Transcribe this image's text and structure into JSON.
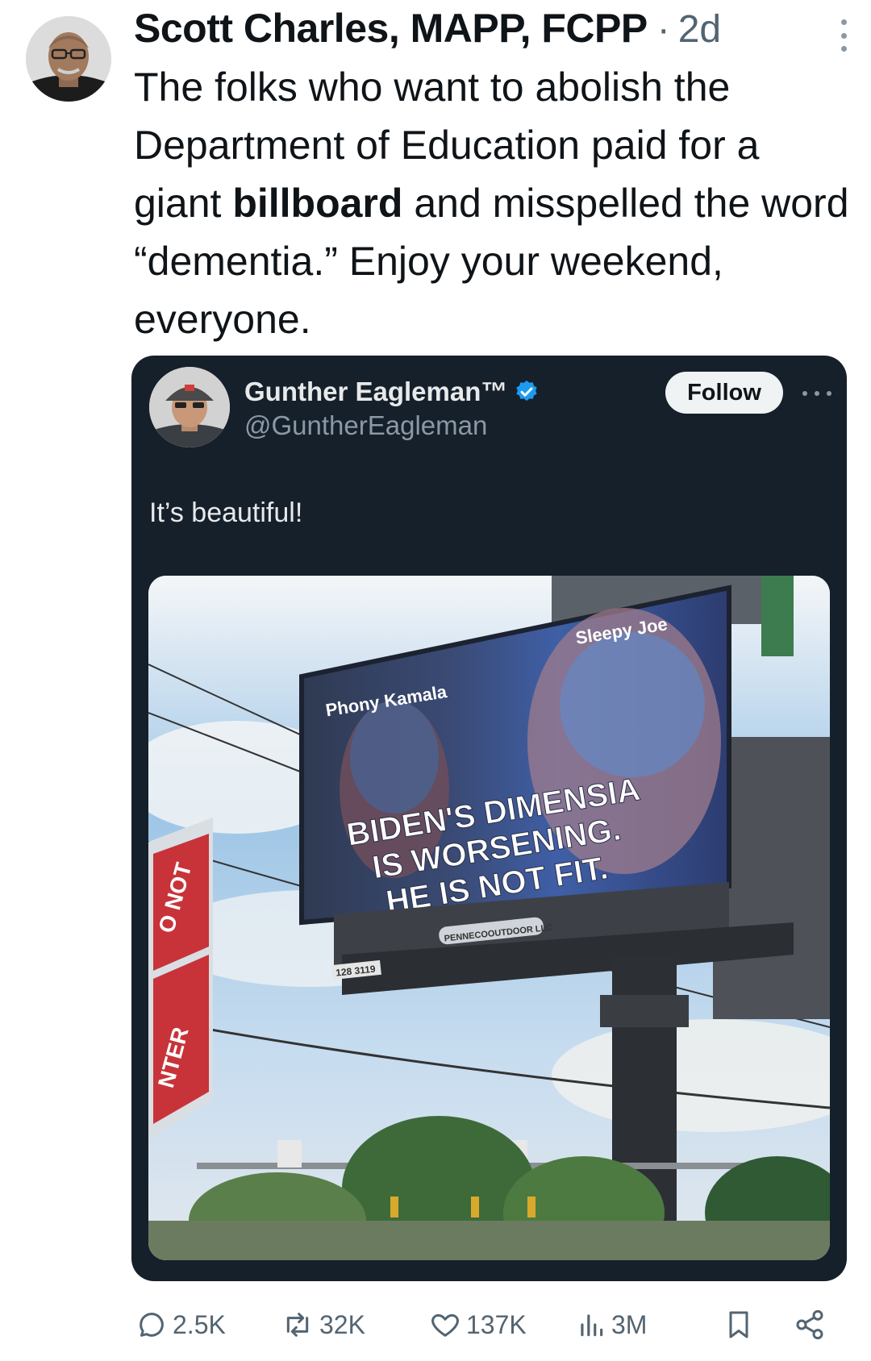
{
  "post": {
    "author_name": "Scott Charles, MAPP, FCPP",
    "separator": "·",
    "time": "2d",
    "text_before": "The folks who want to abolish the Department of Education paid for a giant ",
    "text_bold": "billboard",
    "text_after": " and misspelled the word “dementia.” Enjoy your weekend, everyone."
  },
  "quote": {
    "author_name": "Gunther Eagleman™",
    "handle": "@GuntherEagleman",
    "follow_label": "Follow",
    "text": "It’s beautiful!",
    "image": {
      "label_left": "Phony Kamala",
      "label_right": "Sleepy Joe",
      "headline_lines": [
        "BIDEN'S DIMENSIA",
        "IS WORSENING.",
        "HE IS NOT FIT."
      ],
      "vendor_tag": "PENNECOOUTDOOR LLC",
      "panel_id": "128 3119",
      "sign_top": "O NOT",
      "sign_bottom": "NTER"
    }
  },
  "actions": {
    "replies": "2.5K",
    "reposts": "32K",
    "likes": "137K",
    "views": "3M"
  },
  "colors": {
    "card_bg": "#15202b",
    "verified": "#1d9bf0",
    "muted": "#536471"
  }
}
